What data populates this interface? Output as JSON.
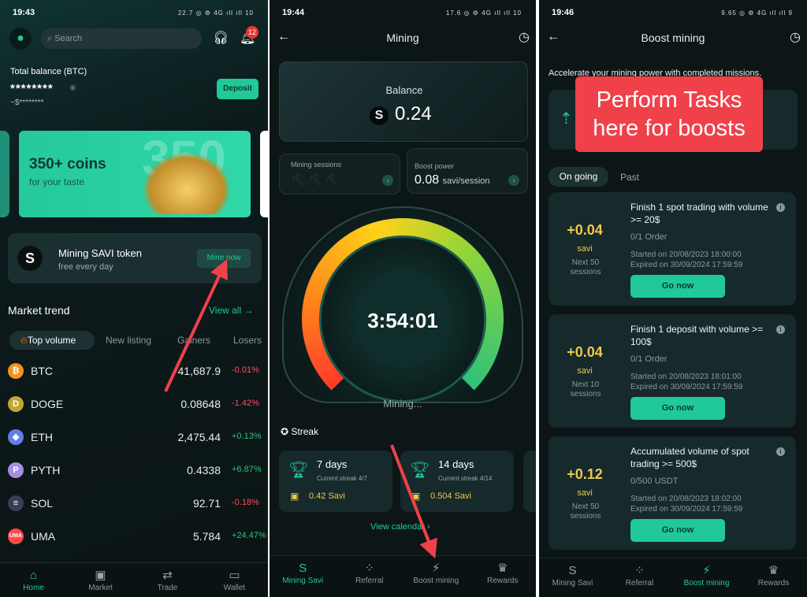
{
  "home": {
    "time": "19:43",
    "status_icons": "22.7 ◎ ⚙ 4G ıll ıll 10",
    "search_placeholder": "Search",
    "notification_count": "12",
    "balance_label": "Total balance (BTC)",
    "balance_hidden": "********",
    "balance_usd_hidden": "~$********",
    "deposit": "Deposit",
    "banner_title": "350+ coins",
    "banner_sub": "for your taste",
    "banner_bg": "350",
    "mining_title": "Mining SAVI token",
    "mining_sub": "free every day",
    "mine_now": "Mine now",
    "market_title": "Market trend",
    "view_all": "View all",
    "tabs": [
      "Top volume",
      "New listing",
      "Gainers",
      "Losers"
    ],
    "rows": [
      {
        "sym": "BTC",
        "price": "41,687.9",
        "change": "-0.01%",
        "color": "#f7931a",
        "g": "₿"
      },
      {
        "sym": "DOGE",
        "price": "0.08648",
        "change": "-1.42%",
        "color": "#c2a633",
        "g": "D"
      },
      {
        "sym": "ETH",
        "price": "2,475.44",
        "change": "+0.13%",
        "color": "#627eea",
        "g": "◆"
      },
      {
        "sym": "PYTH",
        "price": "0.4338",
        "change": "+6.87%",
        "color": "#a88ee0",
        "g": "P"
      },
      {
        "sym": "SOL",
        "price": "92.71",
        "change": "-0.18%",
        "color": "#3a3f55",
        "g": "≡"
      },
      {
        "sym": "UMA",
        "price": "5.784",
        "change": "+24.47%",
        "color": "#ff4a4a",
        "g": "UMA"
      }
    ],
    "nav": [
      "Home",
      "Market",
      "Trade",
      "Wallet"
    ]
  },
  "mining": {
    "time": "19:44",
    "status_icons": "17.6 ◎ ⚙ 4G ıll ıll 10",
    "title": "Mining",
    "balance_label": "Balance",
    "balance": "0.24",
    "sessions_label": "Mining sessions",
    "boost_label": "Boost power",
    "boost_value": "0.08",
    "boost_unit": "savi/session",
    "timer": "3:54:01",
    "status": "Mining...",
    "streak_label": "Streak",
    "streaks": [
      {
        "days": "7 days",
        "current": "Current streak 4/7",
        "reward": "0.42 Savi"
      },
      {
        "days": "14 days",
        "current": "Current streak 4/14",
        "reward": "0.504 Savi"
      }
    ],
    "view_calendar": "View calendar",
    "nav": [
      "Mining Savi",
      "Referral",
      "Boost mining",
      "Rewards"
    ]
  },
  "boost": {
    "time": "19:46",
    "status_icons": "9.65 ◎ ⚙ 4G ıll ıll 9",
    "title": "Boost mining",
    "intro": "Accelerate your mining power with completed missions.",
    "annotation": "Perform Tasks here for boosts",
    "tabs": [
      "On going",
      "Past"
    ],
    "tasks": [
      {
        "amount": "+0.04",
        "unit": "savi",
        "sessions": "Next 50 sessions",
        "title": "Finish 1 spot trading with volume >= 20$",
        "progress": "0/1 Order",
        "started": "Started on 20/08/2023 18:00:00",
        "expired": "Expired on 30/09/2024 17:59:59",
        "button": "Go now"
      },
      {
        "amount": "+0.04",
        "unit": "savi",
        "sessions": "Next 10 sessions",
        "title": "Finish 1 deposit with volume >= 100$",
        "progress": "0/1 Order",
        "started": "Started on 20/08/2023 18:01:00",
        "expired": "Expired on 30/09/2024 17:59:59",
        "button": "Go now"
      },
      {
        "amount": "+0.12",
        "unit": "savi",
        "sessions": "Next 50 sessions",
        "title": "Accumulated volume of spot trading >= 500$",
        "progress": "0/500 USDT",
        "started": "Started on 20/08/2023 18:02:00",
        "expired": "Expired on 30/09/2024 17:59:59",
        "button": "Go now"
      }
    ],
    "nav": [
      "Mining Savi",
      "Referral",
      "Boost mining",
      "Rewards"
    ]
  },
  "colors": {
    "accent": "#20c997",
    "annotation": "#f0414a",
    "gold": "#f0c94b"
  }
}
